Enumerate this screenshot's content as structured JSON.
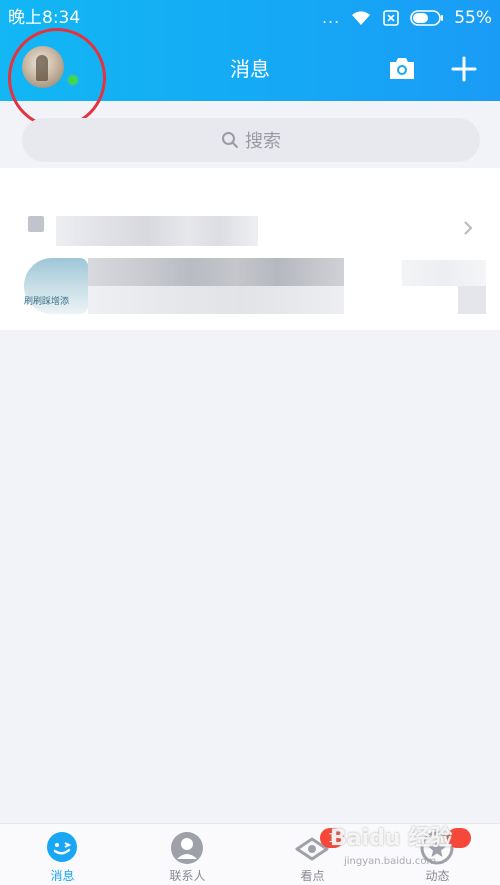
{
  "status_bar": {
    "time": "晚上8:34",
    "dots": "...",
    "battery": "55%"
  },
  "header": {
    "title": "消息",
    "online_color": "#3fd94f",
    "accent": "#15a9f5"
  },
  "search": {
    "label": "搜索"
  },
  "conversation_list": {
    "row_2_caption": "刷刷踩增添"
  },
  "tabs": [
    {
      "label": "消息",
      "icon": "chat-bubble-icon",
      "active": true
    },
    {
      "label": "联系人",
      "icon": "person-icon",
      "active": false
    },
    {
      "label": "看点",
      "icon": "eye-icon",
      "active": false,
      "badge": "1"
    },
    {
      "label": "动态",
      "icon": "star-icon",
      "active": false,
      "badge": ""
    }
  ],
  "watermark": {
    "text": "Baidu 经验",
    "sub": "jingyan.baidu.com"
  },
  "annotation": {
    "color": "#e5323d"
  }
}
